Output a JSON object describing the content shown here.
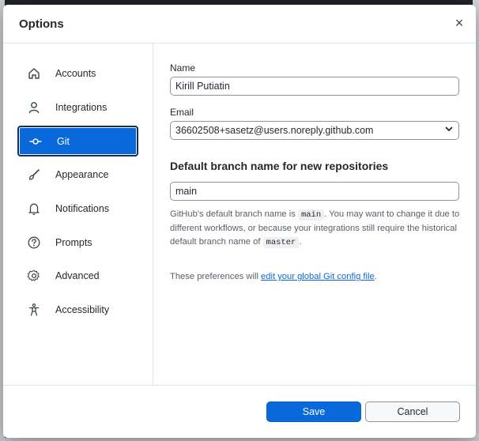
{
  "dialog": {
    "title": "Options",
    "close_glyph": "×"
  },
  "sidebar": {
    "items": [
      {
        "label": "Accounts",
        "icon": "home-icon"
      },
      {
        "label": "Integrations",
        "icon": "person-icon"
      },
      {
        "label": "Git",
        "icon": "git-commit-icon",
        "selected": true
      },
      {
        "label": "Appearance",
        "icon": "paintbrush-icon"
      },
      {
        "label": "Notifications",
        "icon": "bell-icon"
      },
      {
        "label": "Prompts",
        "icon": "question-icon"
      },
      {
        "label": "Advanced",
        "icon": "gear-icon"
      },
      {
        "label": "Accessibility",
        "icon": "accessibility-icon"
      }
    ]
  },
  "git": {
    "name_label": "Name",
    "name_value": "Kirill Putiatin",
    "email_label": "Email",
    "email_value": "36602508+sasetz@users.noreply.github.com",
    "branch_heading": "Default branch name for new repositories",
    "branch_value": "main",
    "desc_part1": "GitHub's default branch name is ",
    "desc_code1": "main",
    "desc_part2": ". You may want to change it due to different workflows, or because your integrations still require the historical default branch name of ",
    "desc_code2": "master",
    "desc_part3": ".",
    "prefs_text": "These preferences will ",
    "prefs_link": "edit your global Git config file",
    "prefs_end": "."
  },
  "footer": {
    "save_label": "Save",
    "cancel_label": "Cancel"
  },
  "colors": {
    "accent": "#0969da",
    "selected_border": "#0a3069"
  }
}
